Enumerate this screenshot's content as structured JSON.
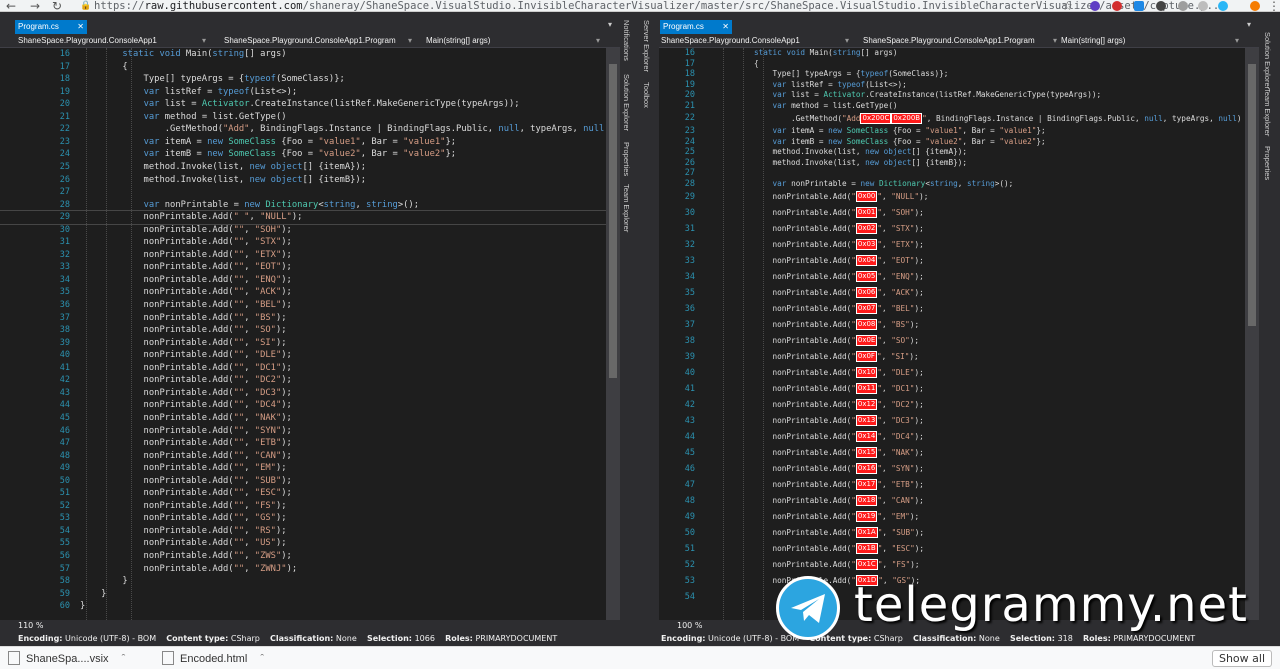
{
  "browser": {
    "url_prefix": "https://",
    "url_host": "raw.githubusercontent.com",
    "url_path": "/shaneray/ShaneSpace.VisualStudio.InvisibleCharacterVisualizer/master/src/ShaneSpace.VisualStudio.InvisibleCharacterVisualizer/assets/capture.p..."
  },
  "left": {
    "tab_label": "Program.cs",
    "nav": [
      "ShaneSpace.Playground.ConsoleApp1",
      "ShaneSpace.Playground.ConsoleApp1.Program",
      "Main(string[] args)"
    ],
    "zoom": "110 %",
    "status": {
      "encoding_label": "Encoding:",
      "encoding": "Unicode (UTF-8) - BOM",
      "content_label": "Content type:",
      "content": "CSharp",
      "class_label": "Classification:",
      "class": "None",
      "sel_label": "Selection:",
      "sel": "1066",
      "roles_label": "Roles:",
      "roles": "PRIMARYDOCUMENT"
    },
    "side_tabs": [
      "Notifications",
      "Solution Explorer",
      "Properties",
      "Team Explorer"
    ]
  },
  "middle_tabs": [
    "Server Explorer",
    "Toolbox"
  ],
  "right": {
    "tab_label": "Program.cs",
    "nav": [
      "ShaneSpace.Playground.ConsoleApp1",
      "ShaneSpace.Playground.ConsoleApp1.Program",
      "Main(string[] args)"
    ],
    "zoom": "100 %",
    "status": {
      "encoding_label": "Encoding:",
      "encoding": "Unicode (UTF-8) - BOM",
      "content_label": "Content type:",
      "content": "CSharp",
      "class_label": "Classification:",
      "class": "None",
      "sel_label": "Selection:",
      "sel": "318",
      "roles_label": "Roles:",
      "roles": "PRIMARYDOCUMENT"
    },
    "side_tabs": [
      "Solution Explorer",
      "Team Explorer",
      "Properties"
    ]
  },
  "code_common": [
    [
      "16",
      [
        [
          "",
          "        "
        ],
        [
          "kw",
          "static"
        ],
        [
          "",
          " "
        ],
        [
          "kw",
          "void"
        ],
        [
          "",
          " Main("
        ],
        [
          "kw",
          "string"
        ],
        [
          "",
          "[] args)"
        ]
      ]
    ],
    [
      "17",
      [
        [
          "",
          "        {"
        ]
      ]
    ],
    [
      "18",
      [
        [
          "",
          "            Type[] typeArgs = {"
        ],
        [
          "kw",
          "typeof"
        ],
        [
          "",
          "(SomeClass)};"
        ]
      ]
    ],
    [
      "19",
      [
        [
          "",
          "            "
        ],
        [
          "kw",
          "var"
        ],
        [
          "",
          " listRef = "
        ],
        [
          "kw",
          "typeof"
        ],
        [
          "",
          "(List<>);"
        ]
      ]
    ],
    [
      "20",
      [
        [
          "",
          "            "
        ],
        [
          "kw",
          "var"
        ],
        [
          "",
          " list = "
        ],
        [
          "ty",
          "Activator"
        ],
        [
          "",
          ".CreateInstance(listRef.MakeGenericType(typeArgs));"
        ]
      ]
    ],
    [
      "21",
      [
        [
          "",
          "            "
        ],
        [
          "kw",
          "var"
        ],
        [
          "",
          " method = list.GetType()"
        ]
      ]
    ]
  ],
  "left_code": [
    [
      "22",
      [
        [
          "",
          "                .GetMethod("
        ],
        [
          "st",
          "\"Add\""
        ],
        [
          "",
          ", BindingFlags.Instance | BindingFlags.Public, "
        ],
        [
          "kw",
          "null"
        ],
        [
          "",
          ", typeArgs, "
        ],
        [
          "kw",
          "null"
        ]
      ]
    ],
    [
      "23",
      [
        [
          "",
          "            "
        ],
        [
          "kw",
          "var"
        ],
        [
          "",
          " itemA = "
        ],
        [
          "kw",
          "new"
        ],
        [
          "",
          " "
        ],
        [
          "ty",
          "SomeClass"
        ],
        [
          "",
          " {Foo = "
        ],
        [
          "st",
          "\"value1\""
        ],
        [
          "",
          ", Bar = "
        ],
        [
          "st",
          "\"value1\""
        ],
        [
          "",
          "};"
        ]
      ]
    ],
    [
      "24",
      [
        [
          "",
          "            "
        ],
        [
          "kw",
          "var"
        ],
        [
          "",
          " itemB = "
        ],
        [
          "kw",
          "new"
        ],
        [
          "",
          " "
        ],
        [
          "ty",
          "SomeClass"
        ],
        [
          "",
          " {Foo = "
        ],
        [
          "st",
          "\"value2\""
        ],
        [
          "",
          ", Bar = "
        ],
        [
          "st",
          "\"value2\""
        ],
        [
          "",
          "};"
        ]
      ]
    ],
    [
      "25",
      [
        [
          "",
          "            method.Invoke(list, "
        ],
        [
          "kw",
          "new"
        ],
        [
          "",
          " "
        ],
        [
          "kw",
          "object"
        ],
        [
          "",
          "[] {itemA});"
        ]
      ]
    ],
    [
      "26",
      [
        [
          "",
          "            method.Invoke(list, "
        ],
        [
          "kw",
          "new"
        ],
        [
          "",
          " "
        ],
        [
          "kw",
          "object"
        ],
        [
          "",
          "[] {itemB});"
        ]
      ]
    ],
    [
      "27",
      [
        [
          "",
          ""
        ]
      ]
    ],
    [
      "28",
      [
        [
          "",
          "            "
        ],
        [
          "kw",
          "var"
        ],
        [
          "",
          " nonPrintable = "
        ],
        [
          "kw",
          "new"
        ],
        [
          "",
          " "
        ],
        [
          "ty",
          "Dictionary"
        ],
        [
          "",
          "<"
        ],
        [
          "kw",
          "string"
        ],
        [
          "",
          ", "
        ],
        [
          "kw",
          "string"
        ],
        [
          "",
          ">();"
        ]
      ]
    ]
  ],
  "right_code": [
    [
      "22",
      [
        [
          "",
          "                .GetMethod("
        ],
        [
          "st",
          "\"Add"
        ],
        [
          "badge",
          "0x200C"
        ],
        [
          "badge",
          "0x200B"
        ],
        [
          "st",
          "\""
        ],
        [
          "",
          ", BindingFlags.Instance | BindingFlags.Public, "
        ],
        [
          "kw",
          "null"
        ],
        [
          "",
          ", typeArgs, "
        ],
        [
          "kw",
          "null"
        ],
        [
          "",
          ")"
        ]
      ]
    ],
    [
      "23",
      [
        [
          "",
          "            "
        ],
        [
          "kw",
          "var"
        ],
        [
          "",
          " itemA = "
        ],
        [
          "kw",
          "new"
        ],
        [
          "",
          " "
        ],
        [
          "ty",
          "SomeClass"
        ],
        [
          "",
          " {Foo = "
        ],
        [
          "st",
          "\"value1\""
        ],
        [
          "",
          ", Bar = "
        ],
        [
          "st",
          "\"value1\""
        ],
        [
          "",
          "};"
        ]
      ]
    ],
    [
      "24",
      [
        [
          "",
          "            "
        ],
        [
          "kw",
          "var"
        ],
        [
          "",
          " itemB = "
        ],
        [
          "kw",
          "new"
        ],
        [
          "",
          " "
        ],
        [
          "ty",
          "SomeClass"
        ],
        [
          "",
          " {Foo = "
        ],
        [
          "st",
          "\"value2\""
        ],
        [
          "",
          ", Bar = "
        ],
        [
          "st",
          "\"value2\""
        ],
        [
          "",
          "};"
        ]
      ]
    ],
    [
      "25",
      [
        [
          "",
          "            method.Invoke(list, "
        ],
        [
          "kw",
          "new"
        ],
        [
          "",
          " "
        ],
        [
          "kw",
          "object"
        ],
        [
          "",
          "[] {itemA});"
        ]
      ]
    ],
    [
      "26",
      [
        [
          "",
          "            method.Invoke(list, "
        ],
        [
          "kw",
          "new"
        ],
        [
          "",
          " "
        ],
        [
          "kw",
          "object"
        ],
        [
          "",
          "[] {itemB});"
        ]
      ]
    ],
    [
      "27",
      [
        [
          "",
          ""
        ]
      ]
    ],
    [
      "28",
      [
        [
          "",
          "            "
        ],
        [
          "kw",
          "var"
        ],
        [
          "",
          " nonPrintable = "
        ],
        [
          "kw",
          "new"
        ],
        [
          "",
          " "
        ],
        [
          "ty",
          "Dictionary"
        ],
        [
          "",
          "<"
        ],
        [
          "kw",
          "string"
        ],
        [
          "",
          ", "
        ],
        [
          "kw",
          "string"
        ],
        [
          "",
          ">();"
        ]
      ]
    ]
  ],
  "left_adds": [
    [
      "29",
      "\" \"",
      "\"NULL\""
    ],
    [
      "30",
      "\"\"",
      "\"SOH\""
    ],
    [
      "31",
      "\"\"",
      "\"STX\""
    ],
    [
      "32",
      "\"\"",
      "\"ETX\""
    ],
    [
      "33",
      "\"\"",
      "\"EOT\""
    ],
    [
      "34",
      "\"\"",
      "\"ENQ\""
    ],
    [
      "35",
      "\"\"",
      "\"ACK\""
    ],
    [
      "36",
      "\"\"",
      "\"BEL\""
    ],
    [
      "37",
      "\"\"",
      "\"BS\""
    ],
    [
      "38",
      "\"\"",
      "\"SO\""
    ],
    [
      "39",
      "\"\"",
      "\"SI\""
    ],
    [
      "40",
      "\"\"",
      "\"DLE\""
    ],
    [
      "41",
      "\"\"",
      "\"DC1\""
    ],
    [
      "42",
      "\"\"",
      "\"DC2\""
    ],
    [
      "43",
      "\"\"",
      "\"DC3\""
    ],
    [
      "44",
      "\"\"",
      "\"DC4\""
    ],
    [
      "45",
      "\"\"",
      "\"NAK\""
    ],
    [
      "46",
      "\"\"",
      "\"SYN\""
    ],
    [
      "47",
      "\"\"",
      "\"ETB\""
    ],
    [
      "48",
      "\"\"",
      "\"CAN\""
    ],
    [
      "49",
      "\"\"",
      "\"EM\""
    ],
    [
      "50",
      "\"\"",
      "\"SUB\""
    ],
    [
      "51",
      "\"\"",
      "\"ESC\""
    ],
    [
      "52",
      "\"\"",
      "\"FS\""
    ],
    [
      "53",
      "\"\"",
      "\"GS\""
    ],
    [
      "54",
      "\"\"",
      "\"RS\""
    ],
    [
      "55",
      "\"\"",
      "\"US\""
    ],
    [
      "56",
      "\"\"",
      "\"ZWS\""
    ],
    [
      "57",
      "\"\"",
      "\"ZWNJ\""
    ]
  ],
  "left_tail": [
    [
      "58",
      "        }"
    ],
    [
      "59",
      "    }"
    ],
    [
      "60",
      "}"
    ]
  ],
  "right_adds": [
    [
      "29",
      "0x00",
      "\"NULL\""
    ],
    [
      "30",
      "0x01",
      "\"SOH\""
    ],
    [
      "31",
      "0x02",
      "\"STX\""
    ],
    [
      "32",
      "0x03",
      "\"ETX\""
    ],
    [
      "33",
      "0x04",
      "\"EOT\""
    ],
    [
      "34",
      "0x05",
      "\"ENQ\""
    ],
    [
      "35",
      "0x06",
      "\"ACK\""
    ],
    [
      "36",
      "0x07",
      "\"BEL\""
    ],
    [
      "37",
      "0x08",
      "\"BS\""
    ],
    [
      "38",
      "0x0E",
      "\"SO\""
    ],
    [
      "39",
      "0x0F",
      "\"SI\""
    ],
    [
      "40",
      "0x10",
      "\"DLE\""
    ],
    [
      "41",
      "0x11",
      "\"DC1\""
    ],
    [
      "42",
      "0x12",
      "\"DC2\""
    ],
    [
      "43",
      "0x13",
      "\"DC3\""
    ],
    [
      "44",
      "0x14",
      "\"DC4\""
    ],
    [
      "45",
      "0x15",
      "\"NAK\""
    ],
    [
      "46",
      "0x16",
      "\"SYN\""
    ],
    [
      "47",
      "0x17",
      "\"ETB\""
    ],
    [
      "48",
      "0x18",
      "\"CAN\""
    ],
    [
      "49",
      "0x19",
      "\"EM\""
    ],
    [
      "50",
      "0x1A",
      "\"SUB\""
    ],
    [
      "51",
      "0x1B",
      "\"ESC\""
    ],
    [
      "52",
      "0x1C",
      "\"FS\""
    ],
    [
      "53",
      "0x1D",
      "\"GS\""
    ],
    [
      "54",
      "",
      ""
    ]
  ],
  "downloads": [
    {
      "name": "ShaneSpa....vsix"
    },
    {
      "name": "Encoded.html"
    }
  ],
  "show_all": "Show all",
  "watermark": "telegrammy.net",
  "colors": {
    "keyword": "#569cd6",
    "type": "#4ec9b0",
    "string": "#d69d85",
    "line_number": "#2b91af",
    "badge": "#ff1a1a",
    "accent": "#007acc"
  }
}
